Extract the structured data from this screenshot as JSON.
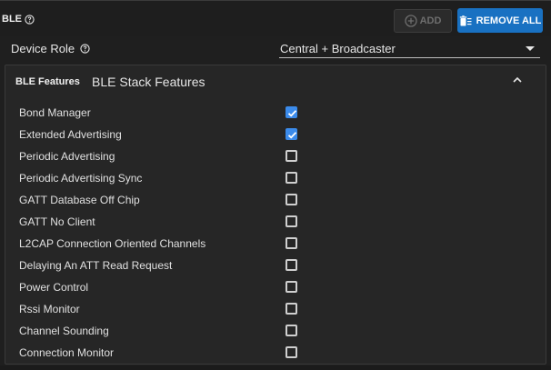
{
  "header": {
    "title": "BLE",
    "help_icon": "help-circle-icon",
    "add_label": "ADD",
    "add_icon": "plus-circle-icon",
    "remove_all_label": "REMOVE ALL",
    "remove_all_icon": "trash-list-icon"
  },
  "device_role": {
    "label": "Device Role",
    "value": "Central + Broadcaster"
  },
  "features_panel": {
    "tag": "BLE Features",
    "title": "BLE Stack Features",
    "items": [
      {
        "label": "Bond Manager",
        "checked": true
      },
      {
        "label": "Extended Advertising",
        "checked": true
      },
      {
        "label": "Periodic Advertising",
        "checked": false
      },
      {
        "label": "Periodic Advertising Sync",
        "checked": false
      },
      {
        "label": "GATT Database Off Chip",
        "checked": false
      },
      {
        "label": "GATT No Client",
        "checked": false
      },
      {
        "label": "L2CAP Connection Oriented Channels",
        "checked": false
      },
      {
        "label": "Delaying An ATT Read Request",
        "checked": false
      },
      {
        "label": "Power Control",
        "checked": false
      },
      {
        "label": "Rssi Monitor",
        "checked": false
      },
      {
        "label": "Channel Sounding",
        "checked": false
      },
      {
        "label": "Connection Monitor",
        "checked": false
      }
    ]
  },
  "colors": {
    "accent": "#1971c2",
    "checkbox_checked": "#3b8beb",
    "background": "#1f1f1f",
    "panel": "#262626"
  }
}
